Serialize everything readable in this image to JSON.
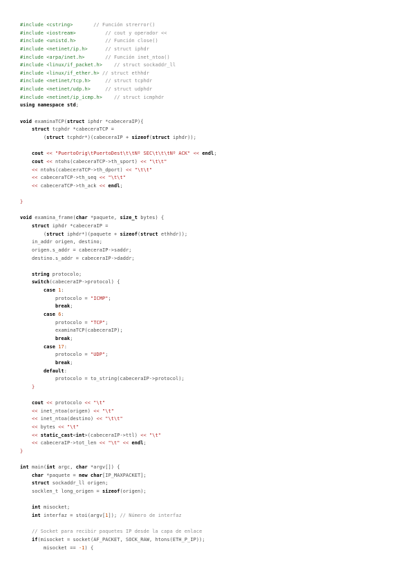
{
  "colors": {
    "preprocessor": "#2e7d32",
    "comment": "#8a8a8a",
    "keyword": "#000000",
    "string": "#b22222",
    "number": "#c04a00",
    "operator": "#b03030",
    "text": "#4a4a4a",
    "background": "#ffffff"
  },
  "lines": [
    {
      "id": "l1",
      "tokens": [
        [
          "pp",
          "#include "
        ],
        [
          "pp",
          "<cstring>"
        ],
        [
          "tx",
          "       "
        ],
        [
          "cm",
          "// Función strerror()"
        ]
      ]
    },
    {
      "id": "l2",
      "tokens": [
        [
          "pp",
          "#include "
        ],
        [
          "pp",
          "<iostream>"
        ],
        [
          "tx",
          "          "
        ],
        [
          "cm",
          "// cout y operador <<"
        ]
      ]
    },
    {
      "id": "l3",
      "tokens": [
        [
          "pp",
          "#include "
        ],
        [
          "pp",
          "<unistd.h>"
        ],
        [
          "tx",
          "          "
        ],
        [
          "cm",
          "// Función close()"
        ]
      ]
    },
    {
      "id": "l4",
      "tokens": [
        [
          "pp",
          "#include "
        ],
        [
          "pp",
          "<netinet/ip.h>"
        ],
        [
          "tx",
          "      "
        ],
        [
          "cm",
          "// struct iphdr"
        ]
      ]
    },
    {
      "id": "l5",
      "tokens": [
        [
          "pp",
          "#include "
        ],
        [
          "pp",
          "<arpa/inet.h>"
        ],
        [
          "tx",
          "       "
        ],
        [
          "cm",
          "// Función inet_ntoa()"
        ]
      ]
    },
    {
      "id": "l6",
      "tokens": [
        [
          "pp",
          "#include "
        ],
        [
          "pp",
          "<linux/if_packet.h>"
        ],
        [
          "tx",
          "    "
        ],
        [
          "cm",
          "// struct sockaddr_ll"
        ]
      ]
    },
    {
      "id": "l7",
      "tokens": [
        [
          "pp",
          "#include "
        ],
        [
          "pp",
          "<linux/if_ether.h>"
        ],
        [
          "tx",
          " "
        ],
        [
          "cm",
          "// struct ethhdr"
        ]
      ]
    },
    {
      "id": "l8",
      "tokens": [
        [
          "pp",
          "#include "
        ],
        [
          "pp",
          "<netinet/tcp.h>"
        ],
        [
          "tx",
          "     "
        ],
        [
          "cm",
          "// struct tcphdr"
        ]
      ]
    },
    {
      "id": "l9",
      "tokens": [
        [
          "pp",
          "#include "
        ],
        [
          "pp",
          "<netinet/udp.h>"
        ],
        [
          "tx",
          "     "
        ],
        [
          "cm",
          "// struct udphdr"
        ]
      ]
    },
    {
      "id": "l10",
      "tokens": [
        [
          "pp",
          "#include "
        ],
        [
          "pp",
          "<netinet/ip_icmp.h>"
        ],
        [
          "tx",
          "    "
        ],
        [
          "cm",
          "// struct icmphdr"
        ]
      ]
    },
    {
      "id": "l11",
      "tokens": [
        [
          "kw",
          "using namespace"
        ],
        [
          "tx",
          " "
        ],
        [
          "kw",
          "std"
        ],
        [
          "pn",
          ";"
        ]
      ]
    },
    {
      "id": "l12",
      "tokens": []
    },
    {
      "id": "l13",
      "tokens": [
        [
          "kw",
          "void"
        ],
        [
          "tx",
          " examinaTCP("
        ],
        [
          "kw",
          "struct"
        ],
        [
          "tx",
          " iphdr *cabeceraIP){"
        ]
      ]
    },
    {
      "id": "l14",
      "tokens": [
        [
          "tx",
          "    "
        ],
        [
          "kw",
          "struct"
        ],
        [
          "tx",
          " tcphdr *cabeceraTCP ="
        ]
      ]
    },
    {
      "id": "l15",
      "tokens": [
        [
          "tx",
          "        ("
        ],
        [
          "kw",
          "struct"
        ],
        [
          "tx",
          " tcphdr*)(cabeceraIP + "
        ],
        [
          "kw",
          "sizeof"
        ],
        [
          "tx",
          "("
        ],
        [
          "kw",
          "struct"
        ],
        [
          "tx",
          " iphdr));"
        ]
      ]
    },
    {
      "id": "l16",
      "tokens": []
    },
    {
      "id": "l17",
      "tokens": [
        [
          "tx",
          "    "
        ],
        [
          "kw",
          "cout"
        ],
        [
          "tx",
          " "
        ],
        [
          "op",
          "<<"
        ],
        [
          "tx",
          " "
        ],
        [
          "st",
          "\"PuertoOrig\\tPuertoDest\\t\\tNº SEC\\t\\t\\tNº ACK\""
        ],
        [
          "tx",
          " "
        ],
        [
          "op",
          "<<"
        ],
        [
          "tx",
          " "
        ],
        [
          "kw",
          "endl"
        ],
        [
          "pn",
          ";"
        ]
      ]
    },
    {
      "id": "l18",
      "tokens": [
        [
          "tx",
          "    "
        ],
        [
          "kw",
          "cout"
        ],
        [
          "tx",
          " "
        ],
        [
          "op",
          "<<"
        ],
        [
          "tx",
          " ntohs(cabeceraTCP->th_sport) "
        ],
        [
          "op",
          "<<"
        ],
        [
          "tx",
          " "
        ],
        [
          "st",
          "\"\\t\\t\""
        ]
      ]
    },
    {
      "id": "l19",
      "tokens": [
        [
          "tx",
          "    "
        ],
        [
          "op",
          "<<"
        ],
        [
          "tx",
          " ntohs(cabeceraTCP->th_dport) "
        ],
        [
          "op",
          "<<"
        ],
        [
          "tx",
          " "
        ],
        [
          "st",
          "\"\\t\\t\""
        ]
      ]
    },
    {
      "id": "l20",
      "tokens": [
        [
          "tx",
          "    "
        ],
        [
          "op",
          "<<"
        ],
        [
          "tx",
          " cabeceraTCP->th_seq "
        ],
        [
          "op",
          "<<"
        ],
        [
          "tx",
          " "
        ],
        [
          "st",
          "\"\\t\\t\""
        ]
      ]
    },
    {
      "id": "l21",
      "tokens": [
        [
          "tx",
          "    "
        ],
        [
          "op",
          "<<"
        ],
        [
          "tx",
          " cabeceraTCP->th_ack "
        ],
        [
          "op",
          "<<"
        ],
        [
          "tx",
          " "
        ],
        [
          "kw",
          "endl"
        ],
        [
          "pn",
          ";"
        ]
      ]
    },
    {
      "id": "l22",
      "tokens": []
    },
    {
      "id": "l23",
      "tokens": [
        [
          "op",
          "}"
        ]
      ]
    },
    {
      "id": "l24",
      "tokens": []
    },
    {
      "id": "l25",
      "tokens": [
        [
          "kw",
          "void"
        ],
        [
          "tx",
          " examina_frame("
        ],
        [
          "kw",
          "char"
        ],
        [
          "tx",
          " *paquete, "
        ],
        [
          "kw",
          "size_t"
        ],
        [
          "tx",
          " bytes) {"
        ]
      ]
    },
    {
      "id": "l26",
      "tokens": [
        [
          "tx",
          "    "
        ],
        [
          "kw",
          "struct"
        ],
        [
          "tx",
          " iphdr *cabeceraIP ="
        ]
      ]
    },
    {
      "id": "l27",
      "tokens": [
        [
          "tx",
          "        ("
        ],
        [
          "kw",
          "struct"
        ],
        [
          "tx",
          " iphdr*)(paquete + "
        ],
        [
          "kw",
          "sizeof"
        ],
        [
          "tx",
          "("
        ],
        [
          "kw",
          "struct"
        ],
        [
          "tx",
          " ethhdr));"
        ]
      ]
    },
    {
      "id": "l28",
      "tokens": [
        [
          "tx",
          "    in_addr origen, destino;"
        ]
      ]
    },
    {
      "id": "l29",
      "tokens": [
        [
          "tx",
          "    origen.s_addr = cabeceraIP->saddr;"
        ]
      ]
    },
    {
      "id": "l30",
      "tokens": [
        [
          "tx",
          "    destino.s_addr = cabeceraIP->daddr;"
        ]
      ]
    },
    {
      "id": "l31",
      "tokens": []
    },
    {
      "id": "l32",
      "tokens": [
        [
          "tx",
          "    "
        ],
        [
          "kw",
          "string"
        ],
        [
          "tx",
          " protocolo;"
        ]
      ]
    },
    {
      "id": "l33",
      "tokens": [
        [
          "tx",
          "    "
        ],
        [
          "kw",
          "switch"
        ],
        [
          "tx",
          "(cabeceraIP->protocol) {"
        ]
      ]
    },
    {
      "id": "l34",
      "tokens": [
        [
          "tx",
          "        "
        ],
        [
          "kw",
          "case"
        ],
        [
          "tx",
          " "
        ],
        [
          "nm",
          "1"
        ],
        [
          "pn",
          ":"
        ]
      ]
    },
    {
      "id": "l35",
      "tokens": [
        [
          "tx",
          "            protocolo = "
        ],
        [
          "st",
          "\"ICMP\""
        ],
        [
          "pn",
          ";"
        ]
      ]
    },
    {
      "id": "l36",
      "tokens": [
        [
          "tx",
          "            "
        ],
        [
          "kw",
          "break"
        ],
        [
          "pn",
          ";"
        ]
      ]
    },
    {
      "id": "l37",
      "tokens": [
        [
          "tx",
          "        "
        ],
        [
          "kw",
          "case"
        ],
        [
          "tx",
          " "
        ],
        [
          "nm",
          "6"
        ],
        [
          "pn",
          ":"
        ]
      ]
    },
    {
      "id": "l38",
      "tokens": [
        [
          "tx",
          "            protocolo = "
        ],
        [
          "st",
          "\"TCP\""
        ],
        [
          "pn",
          ";"
        ]
      ]
    },
    {
      "id": "l39",
      "tokens": [
        [
          "tx",
          "            examinaTCP(cabeceraIP);"
        ]
      ]
    },
    {
      "id": "l40",
      "tokens": [
        [
          "tx",
          "            "
        ],
        [
          "kw",
          "break"
        ],
        [
          "pn",
          ";"
        ]
      ]
    },
    {
      "id": "l41",
      "tokens": [
        [
          "tx",
          "        "
        ],
        [
          "kw",
          "case"
        ],
        [
          "tx",
          " "
        ],
        [
          "nm",
          "17"
        ],
        [
          "pn",
          ":"
        ]
      ]
    },
    {
      "id": "l42",
      "tokens": [
        [
          "tx",
          "            protocolo = "
        ],
        [
          "st",
          "\"UDP\""
        ],
        [
          "pn",
          ";"
        ]
      ]
    },
    {
      "id": "l43",
      "tokens": [
        [
          "tx",
          "            "
        ],
        [
          "kw",
          "break"
        ],
        [
          "pn",
          ";"
        ]
      ]
    },
    {
      "id": "l44",
      "tokens": [
        [
          "tx",
          "        "
        ],
        [
          "kw",
          "default"
        ],
        [
          "pn",
          ":"
        ]
      ]
    },
    {
      "id": "l45",
      "tokens": [
        [
          "tx",
          "            protocolo = to_string(cabeceraIP->protocol);"
        ]
      ]
    },
    {
      "id": "l46",
      "tokens": [
        [
          "tx",
          "    "
        ],
        [
          "op",
          "}"
        ]
      ]
    },
    {
      "id": "l47",
      "tokens": []
    },
    {
      "id": "l48",
      "tokens": [
        [
          "tx",
          "    "
        ],
        [
          "kw",
          "cout"
        ],
        [
          "tx",
          " "
        ],
        [
          "op",
          "<<"
        ],
        [
          "tx",
          " protocolo "
        ],
        [
          "op",
          "<<"
        ],
        [
          "tx",
          " "
        ],
        [
          "st",
          "\"\\t\""
        ]
      ]
    },
    {
      "id": "l49",
      "tokens": [
        [
          "tx",
          "    "
        ],
        [
          "op",
          "<<"
        ],
        [
          "tx",
          " inet_ntoa(origen) "
        ],
        [
          "op",
          "<<"
        ],
        [
          "tx",
          " "
        ],
        [
          "st",
          "\"\\t\""
        ]
      ]
    },
    {
      "id": "l50",
      "tokens": [
        [
          "tx",
          "    "
        ],
        [
          "op",
          "<<"
        ],
        [
          "tx",
          " inet_ntoa(destino) "
        ],
        [
          "op",
          "<<"
        ],
        [
          "tx",
          " "
        ],
        [
          "st",
          "\"\\t\\t\""
        ]
      ]
    },
    {
      "id": "l51",
      "tokens": [
        [
          "tx",
          "    "
        ],
        [
          "op",
          "<<"
        ],
        [
          "tx",
          " bytes "
        ],
        [
          "op",
          "<<"
        ],
        [
          "tx",
          " "
        ],
        [
          "st",
          "\"\\t\""
        ]
      ]
    },
    {
      "id": "l52",
      "tokens": [
        [
          "tx",
          "    "
        ],
        [
          "op",
          "<<"
        ],
        [
          "tx",
          " "
        ],
        [
          "kw",
          "static_cast"
        ],
        [
          "tx",
          "<"
        ],
        [
          "kw",
          "int"
        ],
        [
          "tx",
          ">(cabeceraIP->ttl) "
        ],
        [
          "op",
          "<<"
        ],
        [
          "tx",
          " "
        ],
        [
          "st",
          "\"\\t\""
        ]
      ]
    },
    {
      "id": "l53",
      "tokens": [
        [
          "tx",
          "    "
        ],
        [
          "op",
          "<<"
        ],
        [
          "tx",
          " cabeceraIP->tot_len "
        ],
        [
          "op",
          "<<"
        ],
        [
          "tx",
          " "
        ],
        [
          "st",
          "\"\\t\""
        ],
        [
          "tx",
          " "
        ],
        [
          "op",
          "<<"
        ],
        [
          "tx",
          " "
        ],
        [
          "kw",
          "endl"
        ],
        [
          "pn",
          ";"
        ]
      ]
    },
    {
      "id": "l54",
      "tokens": [
        [
          "op",
          "}"
        ]
      ]
    },
    {
      "id": "l55",
      "tokens": []
    },
    {
      "id": "l56",
      "tokens": [
        [
          "kw",
          "int"
        ],
        [
          "tx",
          " main("
        ],
        [
          "kw",
          "int"
        ],
        [
          "tx",
          " argc, "
        ],
        [
          "kw",
          "char"
        ],
        [
          "tx",
          " *argv[]) {"
        ]
      ]
    },
    {
      "id": "l57",
      "tokens": [
        [
          "tx",
          "    "
        ],
        [
          "kw",
          "char"
        ],
        [
          "tx",
          " *paquete = "
        ],
        [
          "kw",
          "new"
        ],
        [
          "tx",
          " "
        ],
        [
          "kw",
          "char"
        ],
        [
          "tx",
          "[IP_MAXPACKET];"
        ]
      ]
    },
    {
      "id": "l58",
      "tokens": [
        [
          "tx",
          "    "
        ],
        [
          "kw",
          "struct"
        ],
        [
          "tx",
          " sockaddr_ll origen;"
        ]
      ]
    },
    {
      "id": "l59",
      "tokens": [
        [
          "tx",
          "    socklen_t long_origen = "
        ],
        [
          "kw",
          "sizeof"
        ],
        [
          "tx",
          "(origen);"
        ]
      ]
    },
    {
      "id": "l60",
      "tokens": []
    },
    {
      "id": "l61",
      "tokens": [
        [
          "tx",
          "    "
        ],
        [
          "kw",
          "int"
        ],
        [
          "tx",
          " misocket;"
        ]
      ]
    },
    {
      "id": "l62",
      "tokens": [
        [
          "tx",
          "    "
        ],
        [
          "kw",
          "int"
        ],
        [
          "tx",
          " interfaz = stoi(argv["
        ],
        [
          "nm",
          "1"
        ],
        [
          "tx",
          "]); "
        ],
        [
          "cm",
          "// Número de interfaz"
        ]
      ]
    },
    {
      "id": "l63",
      "tokens": []
    },
    {
      "id": "l64",
      "tokens": [
        [
          "tx",
          "    "
        ],
        [
          "cm",
          "// Socket para recibir paquetes IP desde la capa de enlace"
        ]
      ]
    },
    {
      "id": "l65",
      "tokens": [
        [
          "tx",
          "    "
        ],
        [
          "kw",
          "if"
        ],
        [
          "tx",
          "(misocket = socket(AF_PACKET, SOCK_RAW, htons(ETH_P_IP));"
        ]
      ]
    },
    {
      "id": "l66",
      "tokens": [
        [
          "tx",
          "        misocket == "
        ],
        [
          "nm",
          "-1"
        ],
        [
          "tx",
          ") {"
        ]
      ]
    }
  ]
}
